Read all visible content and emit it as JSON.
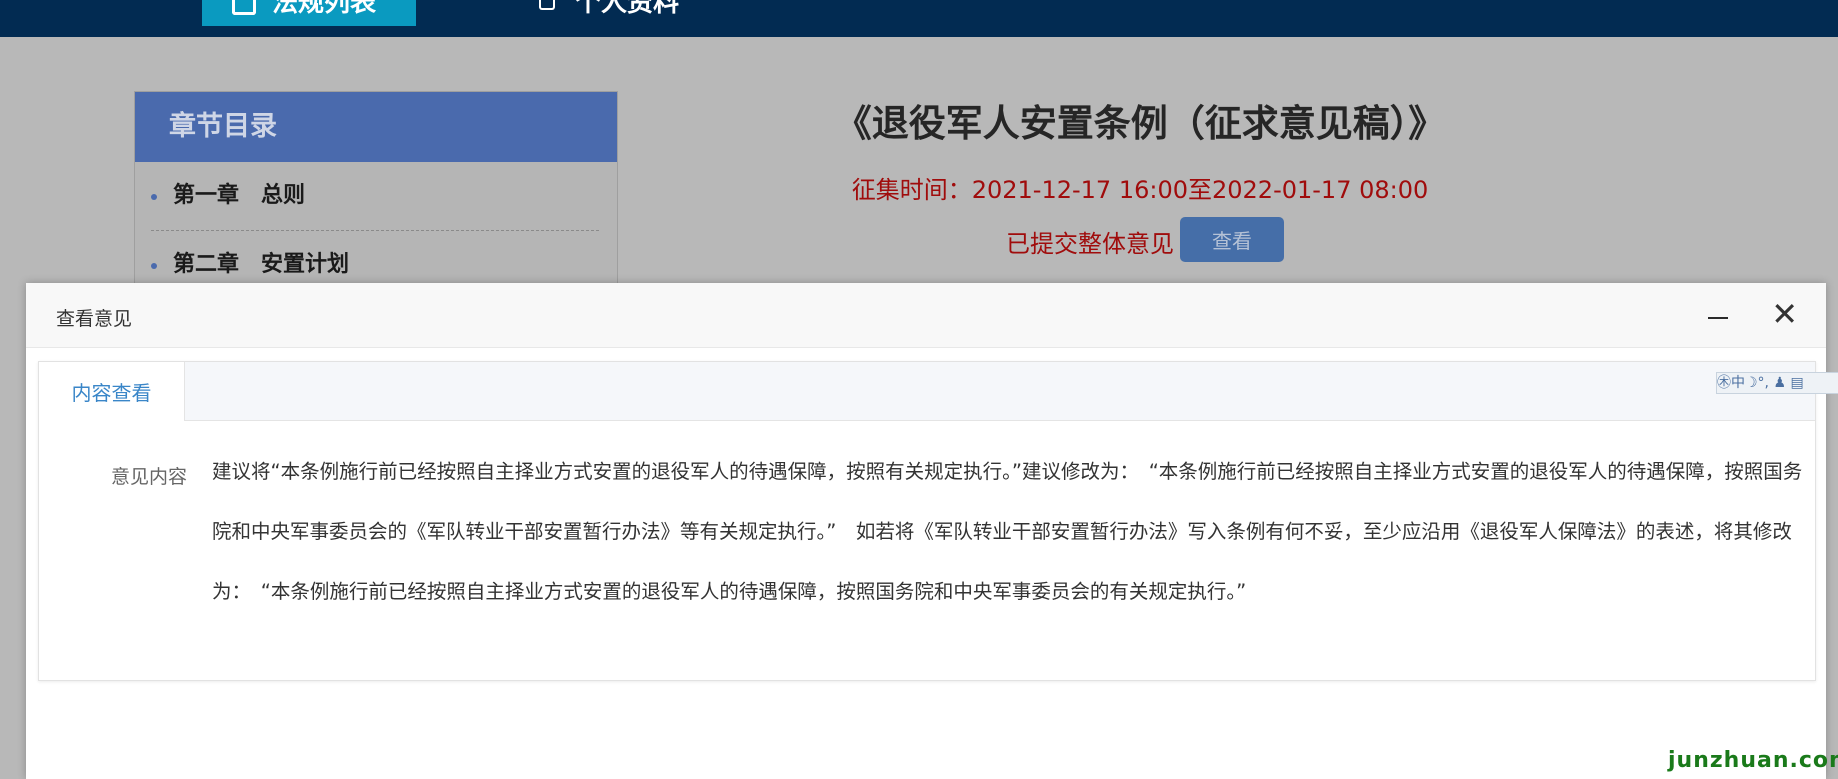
{
  "nav": {
    "active_label": "法规列表",
    "second_label": "个人资料"
  },
  "toc": {
    "heading": "章节目录",
    "items": [
      {
        "label": "第一章　总则"
      },
      {
        "label": "第二章　安置计划"
      }
    ]
  },
  "document": {
    "title": "《退役军人安置条例（征求意见稿）》",
    "collection_time": "征集时间：2021-12-17 16:00至2022-01-17 08:00",
    "submitted_text": "已提交整体意见",
    "view_button": "查看"
  },
  "modal": {
    "title": "查看意见",
    "minimize_icon": "minimize-icon",
    "close_glyph": "✕",
    "tab_label": "内容查看",
    "field_label": "意见内容",
    "field_value": "建议将“本条例施行前已经按照自主择业方式安置的退役军人的待遇保障，按照有关规定执行。”建议修改为：　“本条例施行前已经按照自主择业方式安置的退役军人的待遇保障，按照国务院和中央军事委员会的《军队转业干部安置暂行办法》等有关规定执行。”　如若将《军队转业干部安置暂行办法》写入条例有何不妥，至少应沿用《退役军人保障法》的表述，将其修改为：　“本条例施行前已经按照自主择业方式安置的退役军人的待遇保障，按照国务院和中央军事委员会的有关规定执行。”"
  },
  "ime_toolbar": "㊍中☽°, ♟ ▤",
  "watermark": "junzhuan.com",
  "colors": {
    "nav_bg": "#022b52",
    "nav_active": "#0a9ac0",
    "toc_header": "#4a6aad",
    "alert_red": "#a00c0c",
    "tab_blue": "#3a86c8"
  }
}
